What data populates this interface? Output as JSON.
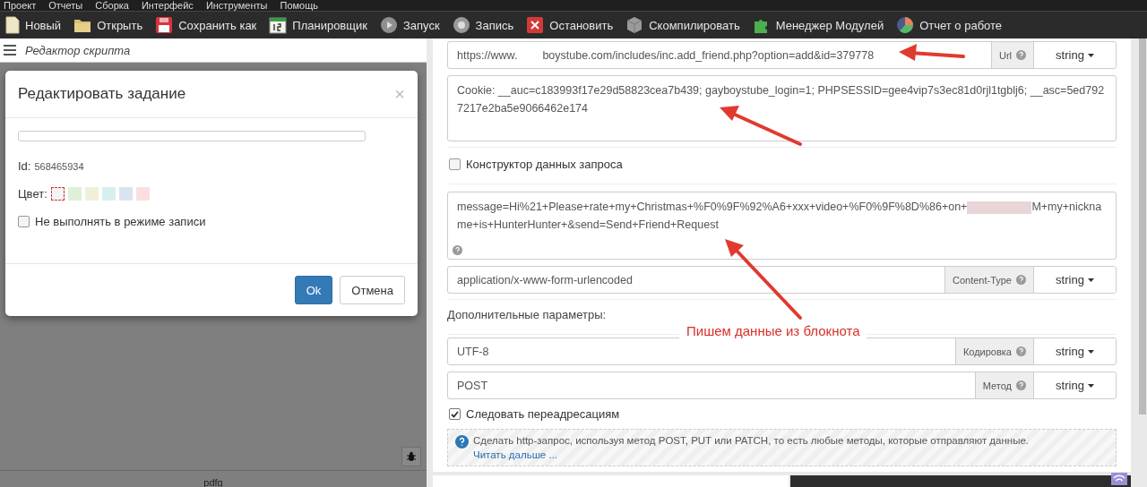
{
  "menu": [
    "Проект",
    "Отчеты",
    "Сборка",
    "Интерфейс",
    "Инструменты",
    "Помощь"
  ],
  "toolbar": [
    {
      "label": "Новый",
      "kind": "new"
    },
    {
      "label": "Открыть",
      "kind": "open"
    },
    {
      "label": "Сохранить как",
      "kind": "save"
    },
    {
      "label": "Планировщик",
      "kind": "calendar"
    },
    {
      "label": "Запуск",
      "kind": "play"
    },
    {
      "label": "Запись",
      "kind": "record"
    },
    {
      "label": "Остановить",
      "kind": "stop"
    },
    {
      "label": "Скомпилировать",
      "kind": "cube"
    },
    {
      "label": "Менеджер Модулей",
      "kind": "puzzle"
    },
    {
      "label": "Отчет о работе",
      "kind": "pie"
    }
  ],
  "left_panel": {
    "title": "Редактор скрипта",
    "footer_text": "pdfg"
  },
  "dialog": {
    "title": "Редактировать задание",
    "close": "×",
    "id_label": "Id:",
    "id_value": "568465934",
    "color_label": "Цвет:",
    "colors": [
      {
        "color": "#f4f4f4",
        "selected": true
      },
      {
        "color": "#dff0d8",
        "selected": false
      },
      {
        "color": "#f1eedb",
        "selected": false
      },
      {
        "color": "#d8eff0",
        "selected": false
      },
      {
        "color": "#dae3f0",
        "selected": false
      },
      {
        "color": "#fbdfe0",
        "selected": false
      }
    ],
    "checkbox": {
      "label": "Не выполнять в режиме записи",
      "checked": false
    },
    "buttons": [
      {
        "label": "Ok",
        "kind": "primary"
      },
      {
        "label": "Отмена",
        "kind": "default"
      }
    ]
  },
  "form": {
    "url": {
      "parts": [
        "https://www.",
        "boystube.com/includes/inc.add_friend.php?option=add&id=379778"
      ],
      "addon": "Url",
      "type": "string"
    },
    "headers": "Cookie:  __auc=c183993f17e29d58823cea7b439; gayboystube_login=1; PHPSESSID=gee4vip7s3ec81d0rjl1tgblj6; __asc=5ed7927217e2ba5e9066462e174",
    "constructor": {
      "label": "Конструктор данных запроса",
      "checked": false
    },
    "body": {
      "before": "message=Hi%21+Please+rate+my+Christmas+%F0%9F%92%A6+xxx+video+%F0%9F%8D%86+on+",
      "after": "M+my+nickname+is+HunterHunter+&send=Send+Friend+Request"
    },
    "content_type": {
      "value": "application/x-www-form-urlencoded",
      "addon": "Content-Type",
      "type": "string"
    },
    "extra_label": "Дополнительные параметры:",
    "params": [
      {
        "value": "UTF-8",
        "addon": "Кодировка",
        "type": "string"
      },
      {
        "value": "POST",
        "addon": "Метод",
        "type": "string"
      }
    ],
    "redirect": {
      "label": "Следовать переадресациям",
      "checked": true
    },
    "info": {
      "text": "Сделать http-запрос, используя метод POST, PUT или PATCH, то есть любые методы, которые отправляют данные.",
      "link": "Читать дальше ..."
    }
  },
  "annotation": {
    "text": "Пишем данные из блокнота"
  }
}
